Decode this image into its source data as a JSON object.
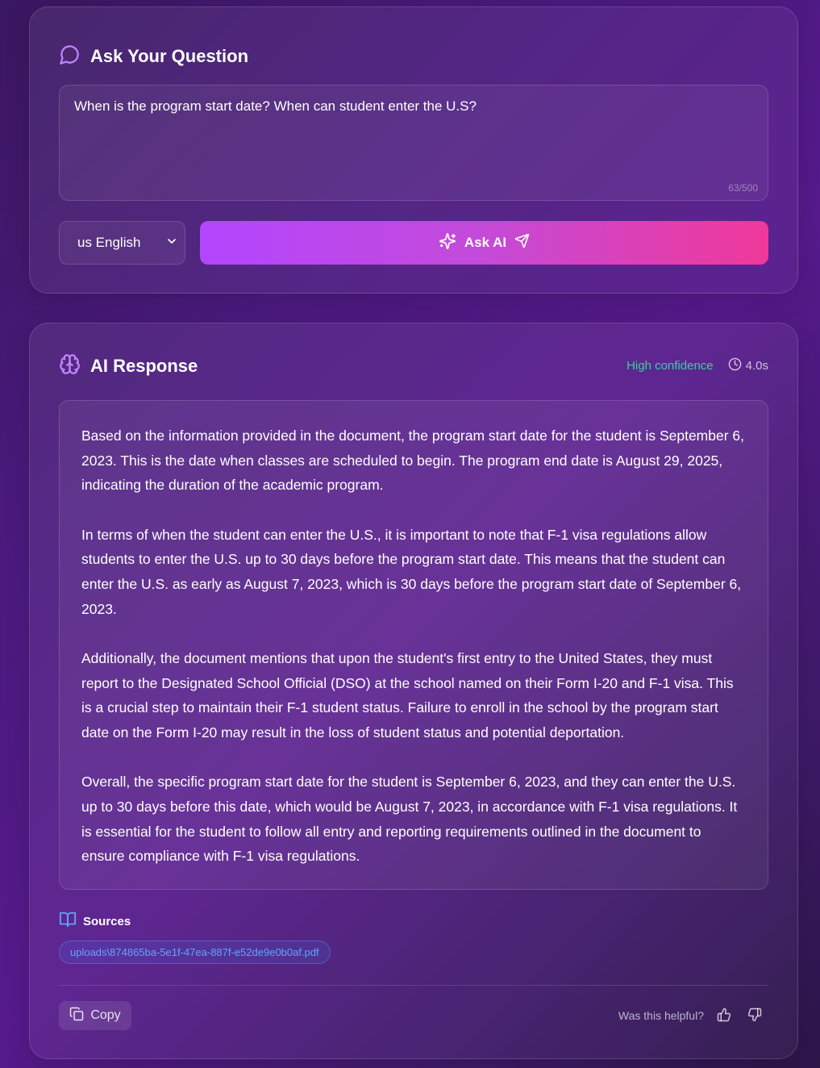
{
  "question_card": {
    "title": "Ask Your Question",
    "question_value": "When is the program start date? When can student enter the U.S?",
    "char_count": "63/500",
    "language_selected": "us English",
    "ask_button_label": "Ask AI"
  },
  "response_card": {
    "title": "AI Response",
    "confidence": "High confidence",
    "duration": "4.0s",
    "paragraphs": [
      "Based on the information provided in the document, the program start date for the student is September 6, 2023. This is the date when classes are scheduled to begin. The program end date is August 29, 2025, indicating the duration of the academic program.",
      "In terms of when the student can enter the U.S., it is important to note that F-1 visa regulations allow students to enter the U.S. up to 30 days before the program start date. This means that the student can enter the U.S. as early as August 7, 2023, which is 30 days before the program start date of September 6, 2023.",
      "Additionally, the document mentions that upon the student's first entry to the United States, they must report to the Designated School Official (DSO) at the school named on their Form I-20 and F-1 visa. This is a crucial step to maintain their F-1 student status. Failure to enroll in the school by the program start date on the Form I-20 may result in the loss of student status and potential deportation.",
      "Overall, the specific program start date for the student is September 6, 2023, and they can enter the U.S. up to 30 days before this date, which would be August 7, 2023, in accordance with F-1 visa regulations. It is essential for the student to follow all entry and reporting requirements outlined in the document to ensure compliance with F-1 visa regulations."
    ],
    "sources_label": "Sources",
    "sources": [
      "uploads\\874865ba-5e1f-47ea-887f-e52de9e0b0af.pdf"
    ],
    "copy_label": "Copy",
    "helpful_label": "Was this helpful?"
  },
  "colors": {
    "accent_purple": "#b346ff",
    "accent_pink": "#f0389a",
    "confidence_green": "#34d399",
    "source_blue": "#60a5fa"
  },
  "icons": [
    "chat-bubble-icon",
    "chevron-down-icon",
    "sparkles-icon",
    "send-icon",
    "brain-icon",
    "clock-icon",
    "book-open-icon",
    "copy-icon",
    "thumbs-up-icon",
    "thumbs-down-icon"
  ]
}
